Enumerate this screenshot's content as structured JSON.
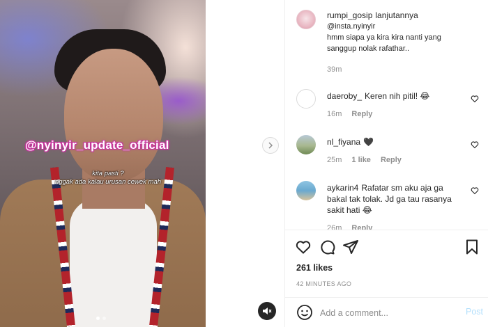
{
  "media": {
    "watermark": "@nyinyir_update_official",
    "subtitle_line1": "kita pasti ?",
    "subtitle_line2": "nggak ada kalau urusan cewek mah"
  },
  "caption": {
    "username": "rumpi_gosip",
    "text_line1": "lanjutannya",
    "text_line2": "@insta.nyinyir",
    "text_line3": "hmm siapa ya kira kira nanti yang",
    "text_line4": "sanggup nolak rafathar..",
    "time": "39m"
  },
  "comments": [
    {
      "username": "daeroby_",
      "text": "Keren nih pitil! 😂",
      "time": "16m",
      "reply": "Reply"
    },
    {
      "username": "nl_fiyana",
      "text": "🖤",
      "time": "25m",
      "likes": "1 like",
      "reply": "Reply"
    },
    {
      "username": "aykarin4",
      "text_line1": "Rafatar sm aku aja ga",
      "text_line2": "bakal tak tolak. Jd ga tau rasanya",
      "text_line3": "sakit hati 😂",
      "time_partial": "26m",
      "reply_partial": "Reply"
    }
  ],
  "actions": {
    "likes": "261 likes",
    "time": "42 MINUTES AGO",
    "comment_placeholder": "Add a comment...",
    "post_label": "Post"
  },
  "colors": {
    "link_blue_disabled": "#b2dffc",
    "text": "#262626",
    "muted": "#8e8e8e",
    "border": "#efefef"
  }
}
